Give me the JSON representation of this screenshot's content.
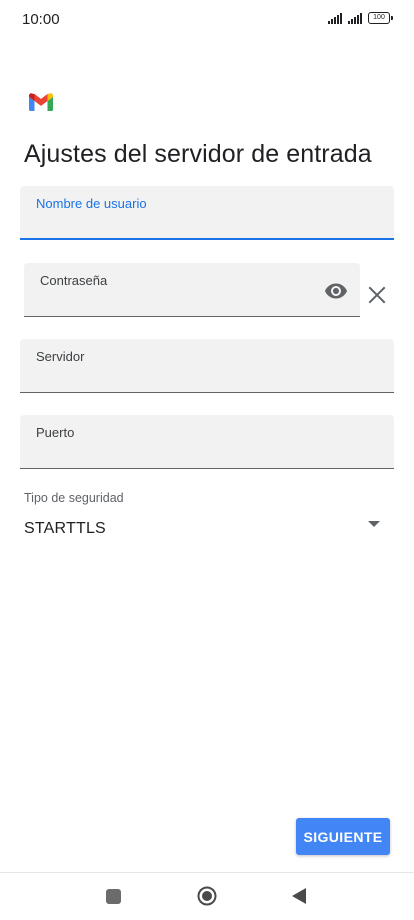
{
  "status_bar": {
    "time": "10:00",
    "battery": "100"
  },
  "page": {
    "title": "Ajustes del servidor de entrada"
  },
  "fields": {
    "username": {
      "label": "Nombre de usuario",
      "value": ""
    },
    "password": {
      "label": "Contraseña",
      "value": ""
    },
    "server": {
      "label": "Servidor",
      "value": ""
    },
    "port": {
      "label": "Puerto",
      "value": ""
    }
  },
  "security": {
    "label": "Tipo de seguridad",
    "value": "STARTTLS"
  },
  "actions": {
    "next_label": "SIGUIENTE"
  },
  "icons": {
    "logo": "gmail-logo",
    "password_toggle": "eye-icon",
    "clear": "close-icon",
    "dropdown": "dropdown-arrow-icon",
    "nav_recents": "square-icon",
    "nav_home": "circle-icon",
    "nav_back": "triangle-back-icon"
  },
  "colors": {
    "accent": "#1a73e8",
    "button": "#4285f4",
    "field_bg": "#f2f2f2",
    "text": "#202124"
  }
}
